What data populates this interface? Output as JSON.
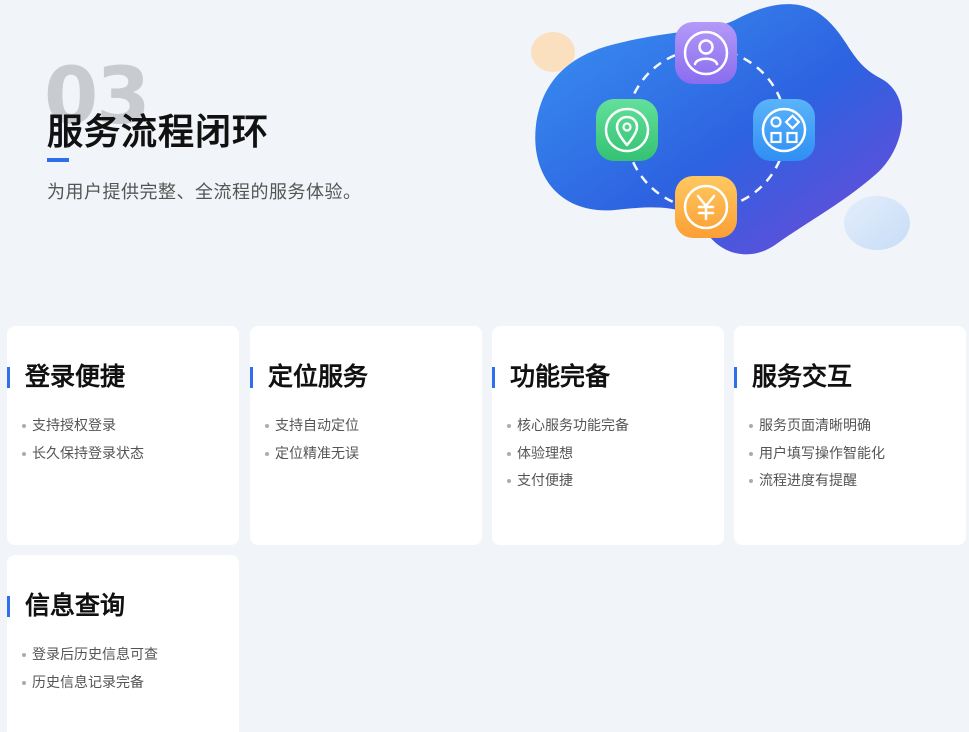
{
  "hero": {
    "number": "03",
    "title": "服务流程闭环",
    "subtitle": "为用户提供完整、全流程的服务体验。"
  },
  "illustration": {
    "icons": [
      "user-icon",
      "location-icon",
      "apps-icon",
      "yuan-icon"
    ],
    "colors": {
      "blob_start": "#3a8cf0",
      "blob_end": "#6a3fd8",
      "user_badge": "#9b7bf2",
      "location_badge": "#49d186",
      "apps_badge": "#3b9bf7",
      "yuan_badge": "#fdb64a"
    }
  },
  "cards": [
    {
      "title": "登录便捷",
      "items": [
        "支持授权登录",
        "长久保持登录状态"
      ]
    },
    {
      "title": "定位服务",
      "items": [
        "支持自动定位",
        "定位精准无误"
      ]
    },
    {
      "title": "功能完备",
      "items": [
        "核心服务功能完备",
        "体验理想",
        "支付便捷"
      ]
    },
    {
      "title": "服务交互",
      "items": [
        "服务页面清晰明确",
        "用户填写操作智能化",
        "流程进度有提醒"
      ]
    },
    {
      "title": "信息查询",
      "items": [
        "登录后历史信息可查",
        "历史信息记录完备"
      ]
    }
  ],
  "colors": {
    "accent": "#2f6fed",
    "background": "#f1f4f8",
    "card": "#ffffff"
  }
}
